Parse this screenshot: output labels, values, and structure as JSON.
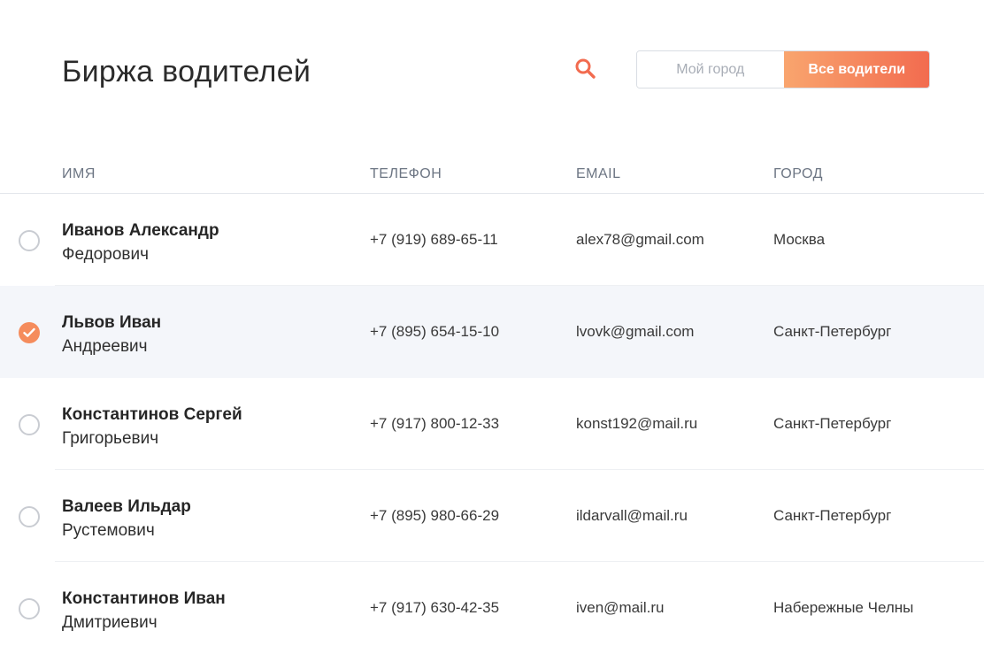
{
  "header": {
    "title": "Биржа водителей",
    "filter": {
      "my_city": "Мой город",
      "all_drivers": "Все водители",
      "active": "all_drivers"
    }
  },
  "icons": {
    "search": "search-icon",
    "check": "check-icon"
  },
  "colors": {
    "accent": "#f26b4f",
    "accent_light": "#f9a56e",
    "selected_row": "#f4f6fa"
  },
  "table": {
    "columns": [
      "ИМЯ",
      "ТЕЛЕФОН",
      "EMAIL",
      "ГОРОД"
    ],
    "rows": [
      {
        "last": "Иванов Александр",
        "first": "Федорович",
        "phone": "+7 (919) 689-65-11",
        "email": "alex78@gmail.com",
        "city": "Москва",
        "selected": false
      },
      {
        "last": "Львов Иван",
        "first": "Андреевич",
        "phone": "+7 (895) 654-15-10",
        "email": "lvovk@gmail.com",
        "city": "Санкт-Петербург",
        "selected": true
      },
      {
        "last": "Константинов Сергей",
        "first": "Григорьевич",
        "phone": "+7 (917) 800-12-33",
        "email": "konst192@mail.ru",
        "city": "Санкт-Петербург",
        "selected": false
      },
      {
        "last": "Валеев Ильдар",
        "first": "Рустемович",
        "phone": "+7 (895) 980-66-29",
        "email": "ildarvall@mail.ru",
        "city": "Санкт-Петербург",
        "selected": false
      },
      {
        "last": "Константинов Иван",
        "first": "Дмитриевич",
        "phone": "+7 (917) 630-42-35",
        "email": "iven@mail.ru",
        "city": "Набережные Челны",
        "selected": false
      }
    ]
  }
}
